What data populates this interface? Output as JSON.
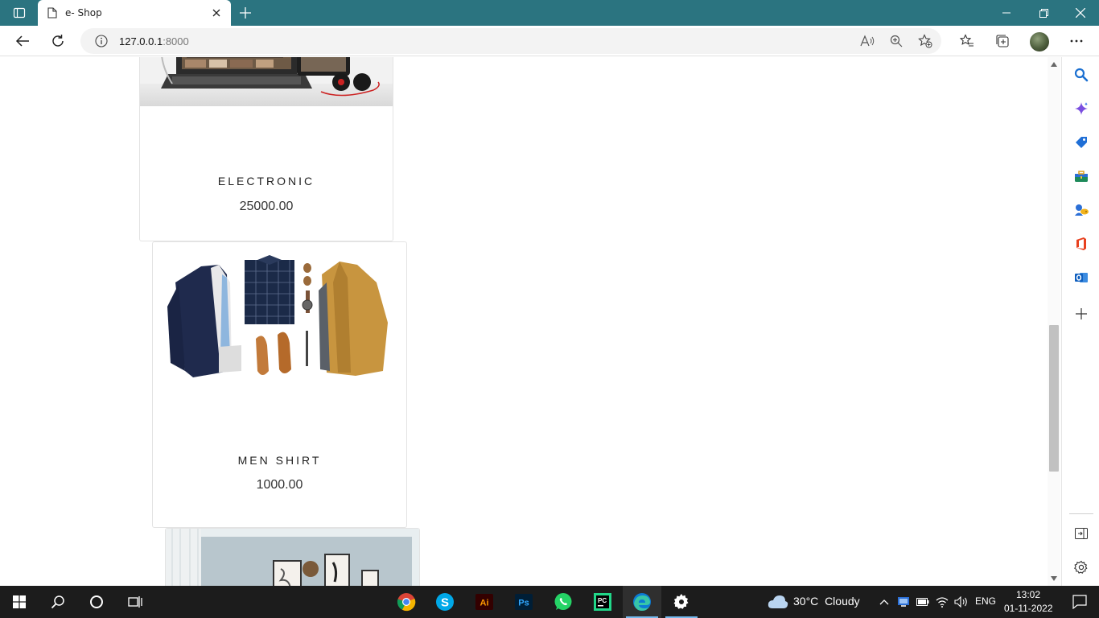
{
  "browser": {
    "tab_title": "e- Shop",
    "address_host": "127.0.0.1",
    "address_port": ":8000"
  },
  "products": [
    {
      "name": "ELECTRONIC",
      "price": "25000.00",
      "image": "laptop-and-headphones"
    },
    {
      "name": "MEN SHIRT",
      "price": "1000.00",
      "image": "men-clothing-flatlay"
    },
    {
      "name": "",
      "price": "",
      "image": "room-interior"
    }
  ],
  "sidebar": {
    "icons": [
      "search-icon",
      "copilot-icon",
      "shopping-tag-icon",
      "tools-icon",
      "games-icon",
      "office-icon",
      "outlook-icon",
      "add-icon",
      "split-screen-icon",
      "settings-icon"
    ]
  },
  "taskbar": {
    "weather_temp": "30°C",
    "weather_condition": "Cloudy",
    "language": "ENG",
    "time": "13:02",
    "date": "01-11-2022",
    "apps": [
      "chrome-icon",
      "skype-icon",
      "illustrator-icon",
      "photoshop-icon",
      "whatsapp-icon",
      "pycharm-icon",
      "edge-icon",
      "settings-app-icon"
    ]
  },
  "colors": {
    "titlebar": "#2b7480",
    "taskbar": "#1c1c1c",
    "accent": "#76b9ed"
  }
}
